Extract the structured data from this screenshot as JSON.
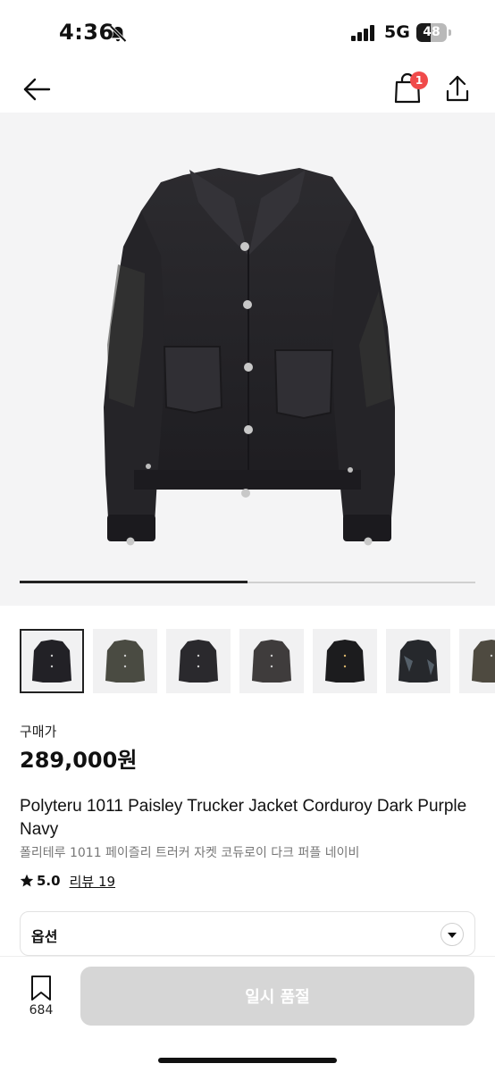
{
  "status_bar": {
    "time": "4:36",
    "network": "5G",
    "battery_level": "48",
    "battery_fraction": 0.48
  },
  "nav": {
    "cart_badge": "1"
  },
  "gallery": {
    "progress_fraction": 0.5,
    "thumbnail_count": 7,
    "selected_index": 0
  },
  "product": {
    "price_label": "구매가",
    "price": "289,000원",
    "title_en": "Polyteru 1011 Paisley Trucker Jacket Corduroy Dark Purple Navy",
    "title_ko": "폴리테루 1011 페이즐리 트러커 자켓 코듀로이 다크 퍼플 네이비",
    "rating": "5.0",
    "review_link": "리뷰 19"
  },
  "options": {
    "label": "옵션"
  },
  "bottom_bar": {
    "bookmark_count": "684",
    "buy_button_label": "일시 품절"
  },
  "colors": {
    "badge": "#f04a4a",
    "buy_button_disabled": "#d6d6d6",
    "hero_background": "#f4f4f5"
  }
}
